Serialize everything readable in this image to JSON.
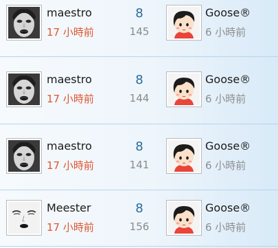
{
  "threads": [
    {
      "last_poster": {
        "name": "maestro",
        "avatar_icon": "woman-dark-lips-avatar-icon"
      },
      "last_time": "17 小時前",
      "replies": "8",
      "views": "145",
      "author": {
        "name": "Goose®",
        "avatar_icon": "cartoon-boy-avatar-icon"
      },
      "author_time": "6 小時前"
    },
    {
      "last_poster": {
        "name": "maestro",
        "avatar_icon": "woman-dark-lips-avatar-icon"
      },
      "last_time": "17 小時前",
      "replies": "8",
      "views": "144",
      "author": {
        "name": "Goose®",
        "avatar_icon": "cartoon-boy-avatar-icon"
      },
      "author_time": "6 小時前"
    },
    {
      "last_poster": {
        "name": "maestro",
        "avatar_icon": "woman-dark-lips-avatar-icon"
      },
      "last_time": "17 小時前",
      "replies": "8",
      "views": "141",
      "author": {
        "name": "Goose®",
        "avatar_icon": "cartoon-boy-avatar-icon"
      },
      "author_time": "6 小時前"
    },
    {
      "last_poster": {
        "name": "Meester",
        "avatar_icon": "sketch-face-avatar-icon"
      },
      "last_time": "17 小時前",
      "replies": "8",
      "views": "156",
      "author": {
        "name": "Goose®",
        "avatar_icon": "cartoon-boy-avatar-icon"
      },
      "author_time": "6 小時前"
    }
  ],
  "colors": {
    "time_highlight": "#e0542e",
    "reply_count": "#2a6a9a",
    "divider": "#b7d4ea"
  }
}
